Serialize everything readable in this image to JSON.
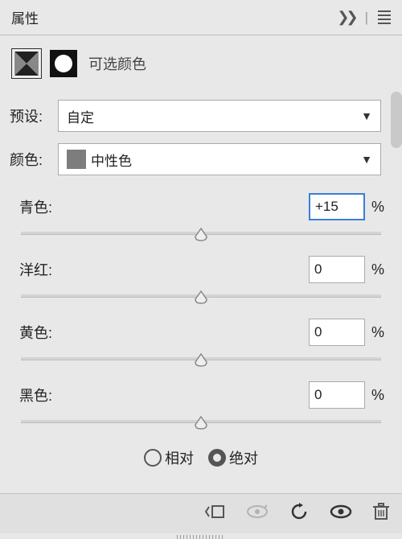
{
  "titlebar": {
    "title": "属性"
  },
  "adjustment": {
    "label": "可选颜色"
  },
  "preset": {
    "label": "预设:",
    "value": "自定"
  },
  "color": {
    "label": "颜色:",
    "value": "中性色",
    "swatch": "#7d7d7d"
  },
  "sliders": [
    {
      "label": "青色:",
      "value": "+15",
      "active": true,
      "pos": 50
    },
    {
      "label": "洋红:",
      "value": "0",
      "active": false,
      "pos": 50
    },
    {
      "label": "黄色:",
      "value": "0",
      "active": false,
      "pos": 50
    },
    {
      "label": "黑色:",
      "value": "0",
      "active": false,
      "pos": 50
    }
  ],
  "method": {
    "relative": {
      "label": "相对",
      "checked": false
    },
    "absolute": {
      "label": "绝对",
      "checked": true
    }
  },
  "unit": "%"
}
